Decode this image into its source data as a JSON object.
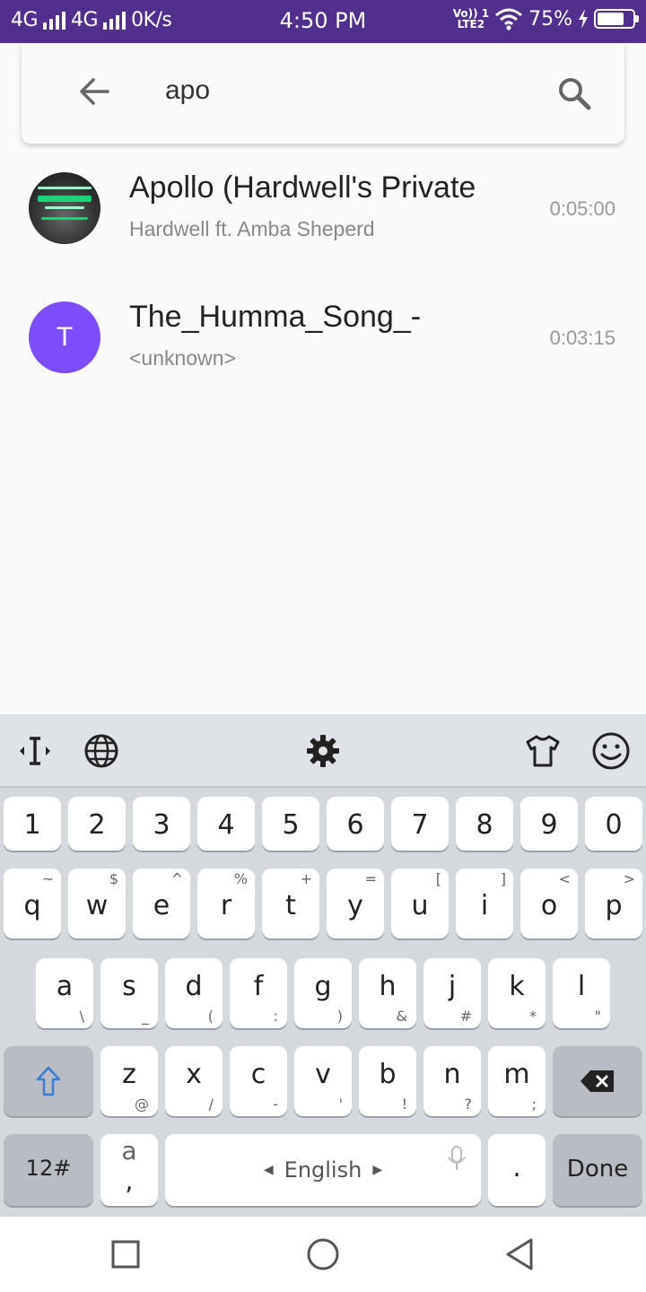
{
  "status_bar": {
    "network1": "4G",
    "network2": "4G",
    "speed": "0K/s",
    "time": "4:50 PM",
    "volte": "Vo)) 1",
    "lte": "LTE2",
    "battery": "75%",
    "battery_level": 0.75
  },
  "search": {
    "query": "apo",
    "back_icon": "arrow-left-icon",
    "search_icon": "search-icon"
  },
  "results": [
    {
      "title": "Apollo (Hardwell's Private",
      "subtitle": "Hardwell ft. Amba Sheperd",
      "duration": "0:05:00",
      "art_text": "APOLLO"
    },
    {
      "title": "The_Humma_Song_-",
      "subtitle": "<unknown>",
      "duration": "0:03:15",
      "avatar_letter": "T",
      "avatar_color": "#7c4dff"
    }
  ],
  "keyboard": {
    "toolbar": [
      "cursor-icon",
      "globe-icon",
      "settings-icon",
      "theme-shirt-icon",
      "emoji-icon"
    ],
    "number_row": [
      "1",
      "2",
      "3",
      "4",
      "5",
      "6",
      "7",
      "8",
      "9",
      "0"
    ],
    "row1": [
      {
        "key": "q",
        "hint": "~"
      },
      {
        "key": "w",
        "hint": "$"
      },
      {
        "key": "e",
        "hint": "^"
      },
      {
        "key": "r",
        "hint": "%"
      },
      {
        "key": "t",
        "hint": "+"
      },
      {
        "key": "y",
        "hint": "="
      },
      {
        "key": "u",
        "hint": "["
      },
      {
        "key": "i",
        "hint": "]"
      },
      {
        "key": "o",
        "hint": "<"
      },
      {
        "key": "p",
        "hint": ">"
      }
    ],
    "row2": [
      {
        "key": "a",
        "hint": "\\"
      },
      {
        "key": "s",
        "hint": "_"
      },
      {
        "key": "d",
        "hint": "("
      },
      {
        "key": "f",
        "hint": ":"
      },
      {
        "key": "g",
        "hint": ")"
      },
      {
        "key": "h",
        "hint": "&"
      },
      {
        "key": "j",
        "hint": "#"
      },
      {
        "key": "k",
        "hint": "*"
      },
      {
        "key": "l",
        "hint": "\""
      }
    ],
    "row3": [
      {
        "key": "z",
        "hint": "@"
      },
      {
        "key": "x",
        "hint": "/"
      },
      {
        "key": "c",
        "hint": "-"
      },
      {
        "key": "v",
        "hint": "'"
      },
      {
        "key": "b",
        "hint": "!"
      },
      {
        "key": "n",
        "hint": "?"
      },
      {
        "key": "m",
        "hint": ";"
      }
    ],
    "symbols_label": "12#",
    "comma_key": "a",
    "comma_hint": ",",
    "space_label": "English",
    "period_label": ".",
    "done_label": "Done"
  },
  "accent_color": "#512f8f"
}
